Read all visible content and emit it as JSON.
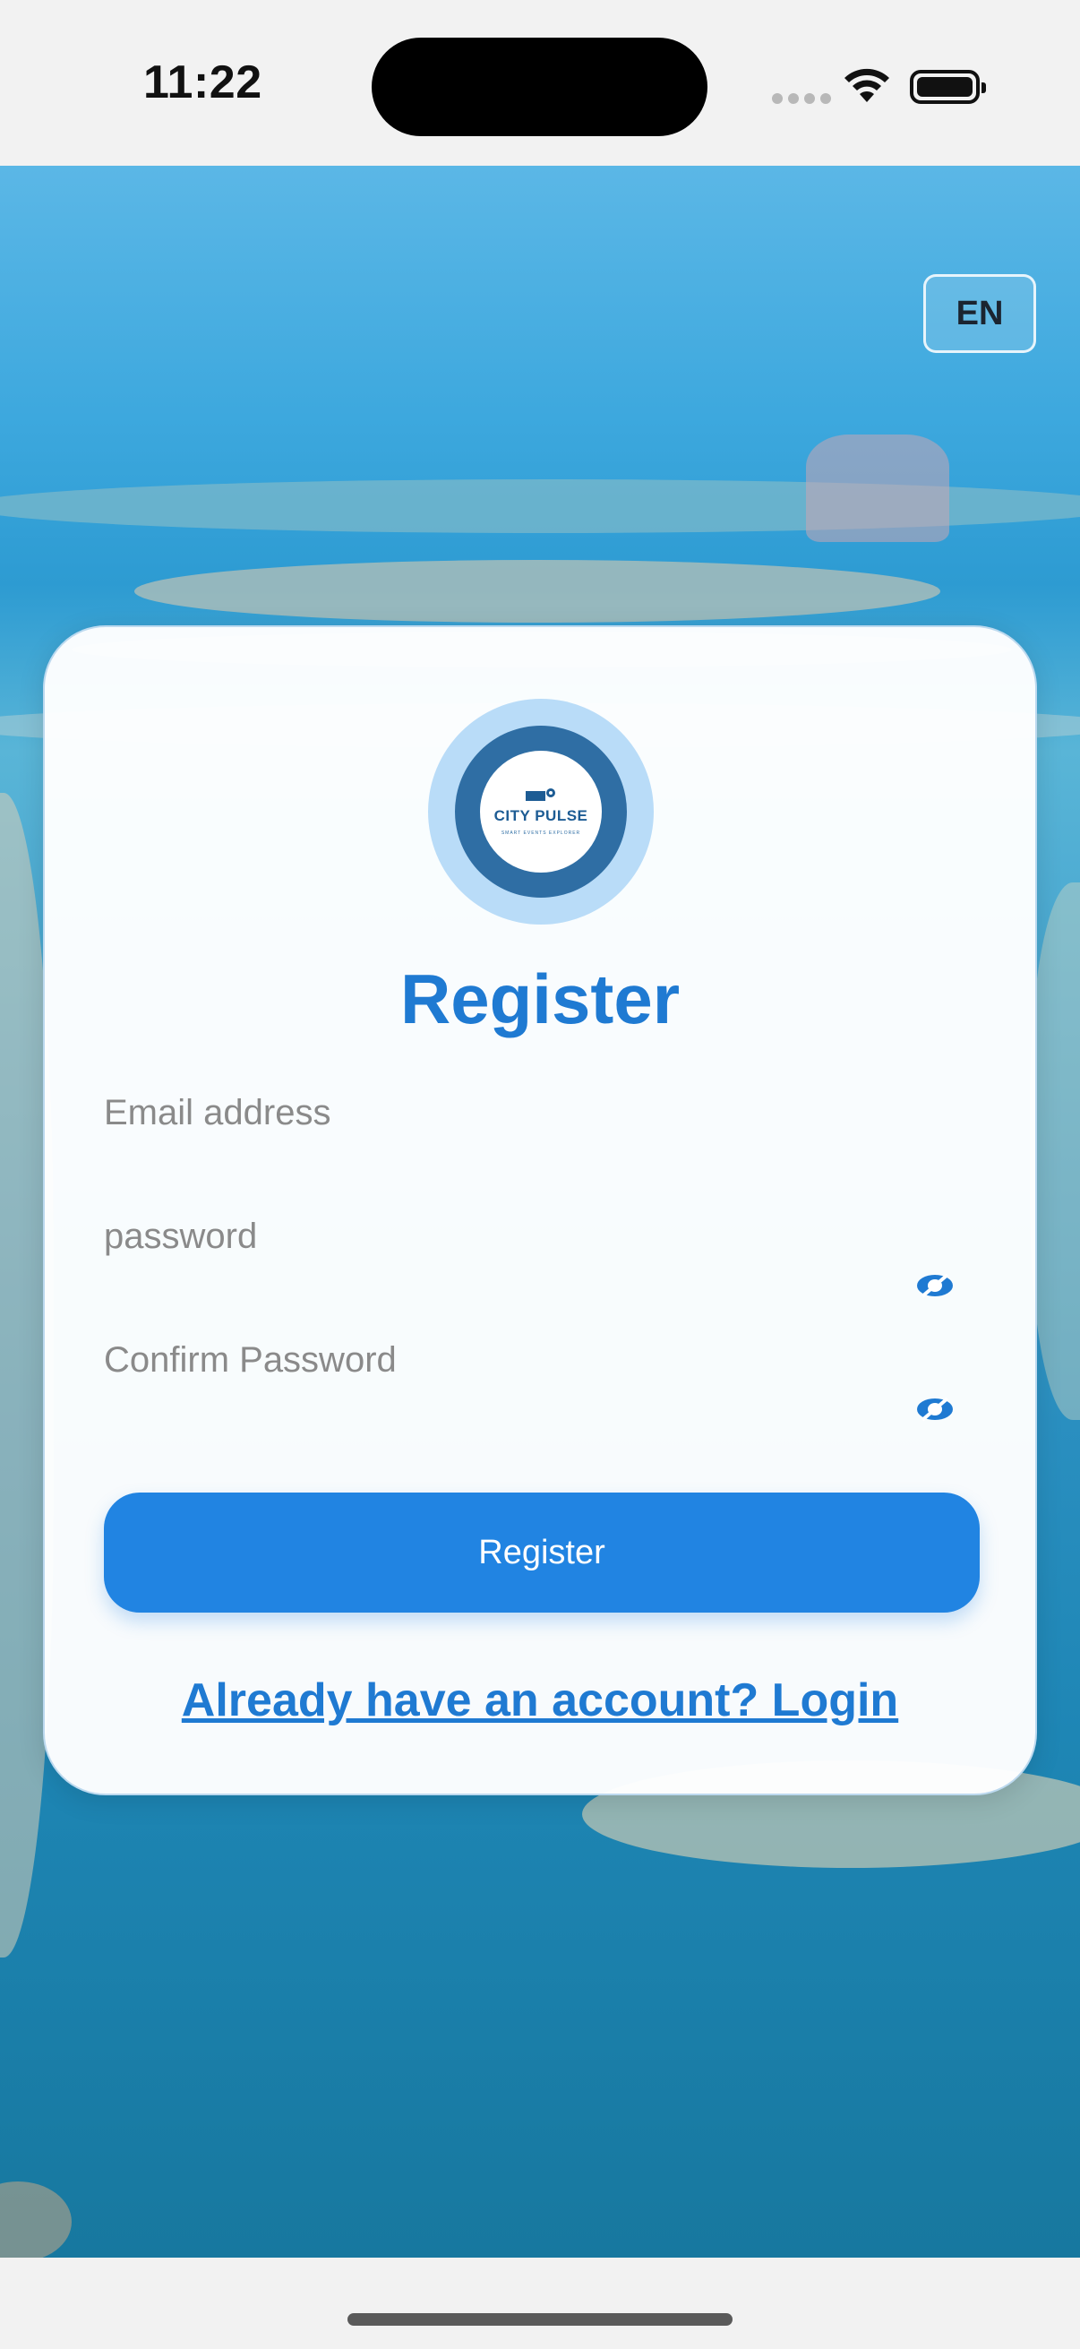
{
  "status_bar": {
    "time": "11:22"
  },
  "language_button": {
    "label": "EN"
  },
  "logo": {
    "name": "CITY PULSE",
    "tagline": "SMART EVENTS EXPLORER"
  },
  "form": {
    "title": "Register",
    "email": {
      "placeholder": "Email address"
    },
    "password": {
      "placeholder": "password"
    },
    "confirm_password": {
      "placeholder": "Confirm Password"
    },
    "submit_label": "Register",
    "login_link": "Already have an account? Login"
  },
  "colors": {
    "accent": "#2184e2",
    "title": "#1f7ad2",
    "logo_ring": "#2f6ea4",
    "logo_halo": "#b9dcf8"
  },
  "icons": [
    "wifi-icon",
    "battery-icon",
    "eye-slash-icon"
  ]
}
